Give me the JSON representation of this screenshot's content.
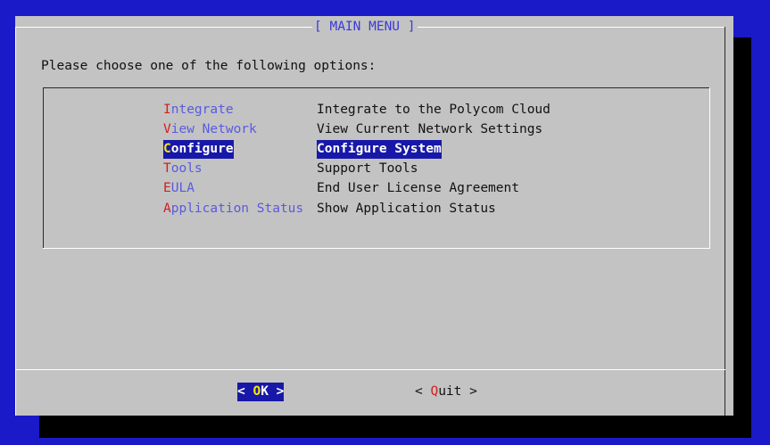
{
  "dialog": {
    "title": "[ MAIN MENU ]",
    "prompt": "Please choose one of the following options:"
  },
  "menu": {
    "items": [
      {
        "hotkey": "I",
        "rest": "ntegrate",
        "description": "Integrate to the Polycom Cloud",
        "selected": false
      },
      {
        "hotkey": "V",
        "rest": "iew Network",
        "description": "View Current Network Settings",
        "selected": false
      },
      {
        "hotkey": "C",
        "rest": "onfigure",
        "description": "Configure System",
        "selected": true
      },
      {
        "hotkey": "T",
        "rest": "ools",
        "description": "Support Tools",
        "selected": false
      },
      {
        "hotkey": "E",
        "rest": "ULA",
        "description": "End User License Agreement",
        "selected": false
      },
      {
        "hotkey": "A",
        "rest": "pplication Status",
        "description": "Show Application Status",
        "selected": false
      }
    ]
  },
  "buttons": {
    "ok": {
      "left": "< ",
      "hotkey": "O",
      "rest": "K",
      "right": " >",
      "focused": true
    },
    "quit": {
      "left": "< ",
      "hotkey": "Q",
      "rest": "uit",
      "right": " >",
      "focused": false
    }
  },
  "colors": {
    "background": "#1a1ac8",
    "dialog": "#c3c3c3",
    "selection": "#1818a8",
    "hotkey": "#d02020",
    "selected_hotkey": "#ffe600",
    "menu_tag": "#5a5ae0"
  }
}
